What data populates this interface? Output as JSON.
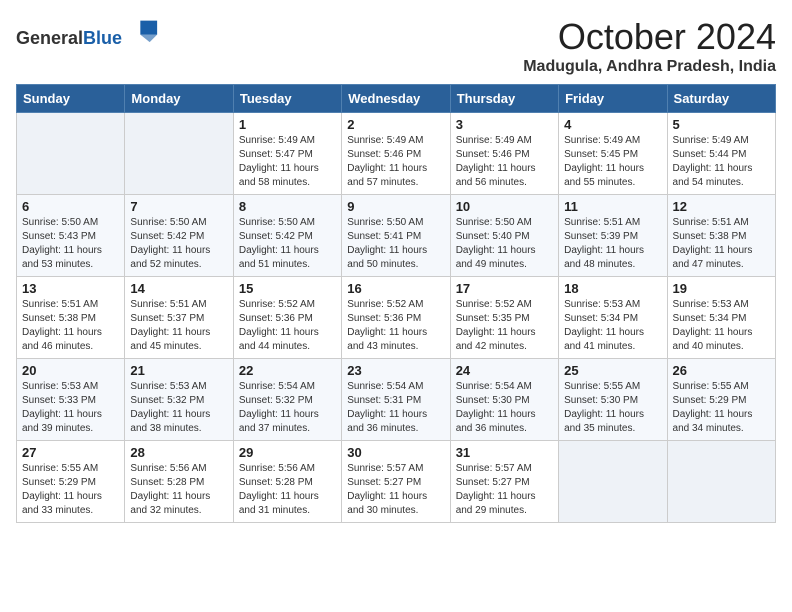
{
  "header": {
    "logo_general": "General",
    "logo_blue": "Blue",
    "month_title": "October 2024",
    "location": "Madugula, Andhra Pradesh, India"
  },
  "weekdays": [
    "Sunday",
    "Monday",
    "Tuesday",
    "Wednesday",
    "Thursday",
    "Friday",
    "Saturday"
  ],
  "weeks": [
    [
      {
        "day": "",
        "sunrise": "",
        "sunset": "",
        "daylight": ""
      },
      {
        "day": "",
        "sunrise": "",
        "sunset": "",
        "daylight": ""
      },
      {
        "day": "1",
        "sunrise": "Sunrise: 5:49 AM",
        "sunset": "Sunset: 5:47 PM",
        "daylight": "Daylight: 11 hours and 58 minutes."
      },
      {
        "day": "2",
        "sunrise": "Sunrise: 5:49 AM",
        "sunset": "Sunset: 5:46 PM",
        "daylight": "Daylight: 11 hours and 57 minutes."
      },
      {
        "day": "3",
        "sunrise": "Sunrise: 5:49 AM",
        "sunset": "Sunset: 5:46 PM",
        "daylight": "Daylight: 11 hours and 56 minutes."
      },
      {
        "day": "4",
        "sunrise": "Sunrise: 5:49 AM",
        "sunset": "Sunset: 5:45 PM",
        "daylight": "Daylight: 11 hours and 55 minutes."
      },
      {
        "day": "5",
        "sunrise": "Sunrise: 5:49 AM",
        "sunset": "Sunset: 5:44 PM",
        "daylight": "Daylight: 11 hours and 54 minutes."
      }
    ],
    [
      {
        "day": "6",
        "sunrise": "Sunrise: 5:50 AM",
        "sunset": "Sunset: 5:43 PM",
        "daylight": "Daylight: 11 hours and 53 minutes."
      },
      {
        "day": "7",
        "sunrise": "Sunrise: 5:50 AM",
        "sunset": "Sunset: 5:42 PM",
        "daylight": "Daylight: 11 hours and 52 minutes."
      },
      {
        "day": "8",
        "sunrise": "Sunrise: 5:50 AM",
        "sunset": "Sunset: 5:42 PM",
        "daylight": "Daylight: 11 hours and 51 minutes."
      },
      {
        "day": "9",
        "sunrise": "Sunrise: 5:50 AM",
        "sunset": "Sunset: 5:41 PM",
        "daylight": "Daylight: 11 hours and 50 minutes."
      },
      {
        "day": "10",
        "sunrise": "Sunrise: 5:50 AM",
        "sunset": "Sunset: 5:40 PM",
        "daylight": "Daylight: 11 hours and 49 minutes."
      },
      {
        "day": "11",
        "sunrise": "Sunrise: 5:51 AM",
        "sunset": "Sunset: 5:39 PM",
        "daylight": "Daylight: 11 hours and 48 minutes."
      },
      {
        "day": "12",
        "sunrise": "Sunrise: 5:51 AM",
        "sunset": "Sunset: 5:38 PM",
        "daylight": "Daylight: 11 hours and 47 minutes."
      }
    ],
    [
      {
        "day": "13",
        "sunrise": "Sunrise: 5:51 AM",
        "sunset": "Sunset: 5:38 PM",
        "daylight": "Daylight: 11 hours and 46 minutes."
      },
      {
        "day": "14",
        "sunrise": "Sunrise: 5:51 AM",
        "sunset": "Sunset: 5:37 PM",
        "daylight": "Daylight: 11 hours and 45 minutes."
      },
      {
        "day": "15",
        "sunrise": "Sunrise: 5:52 AM",
        "sunset": "Sunset: 5:36 PM",
        "daylight": "Daylight: 11 hours and 44 minutes."
      },
      {
        "day": "16",
        "sunrise": "Sunrise: 5:52 AM",
        "sunset": "Sunset: 5:36 PM",
        "daylight": "Daylight: 11 hours and 43 minutes."
      },
      {
        "day": "17",
        "sunrise": "Sunrise: 5:52 AM",
        "sunset": "Sunset: 5:35 PM",
        "daylight": "Daylight: 11 hours and 42 minutes."
      },
      {
        "day": "18",
        "sunrise": "Sunrise: 5:53 AM",
        "sunset": "Sunset: 5:34 PM",
        "daylight": "Daylight: 11 hours and 41 minutes."
      },
      {
        "day": "19",
        "sunrise": "Sunrise: 5:53 AM",
        "sunset": "Sunset: 5:34 PM",
        "daylight": "Daylight: 11 hours and 40 minutes."
      }
    ],
    [
      {
        "day": "20",
        "sunrise": "Sunrise: 5:53 AM",
        "sunset": "Sunset: 5:33 PM",
        "daylight": "Daylight: 11 hours and 39 minutes."
      },
      {
        "day": "21",
        "sunrise": "Sunrise: 5:53 AM",
        "sunset": "Sunset: 5:32 PM",
        "daylight": "Daylight: 11 hours and 38 minutes."
      },
      {
        "day": "22",
        "sunrise": "Sunrise: 5:54 AM",
        "sunset": "Sunset: 5:32 PM",
        "daylight": "Daylight: 11 hours and 37 minutes."
      },
      {
        "day": "23",
        "sunrise": "Sunrise: 5:54 AM",
        "sunset": "Sunset: 5:31 PM",
        "daylight": "Daylight: 11 hours and 36 minutes."
      },
      {
        "day": "24",
        "sunrise": "Sunrise: 5:54 AM",
        "sunset": "Sunset: 5:30 PM",
        "daylight": "Daylight: 11 hours and 36 minutes."
      },
      {
        "day": "25",
        "sunrise": "Sunrise: 5:55 AM",
        "sunset": "Sunset: 5:30 PM",
        "daylight": "Daylight: 11 hours and 35 minutes."
      },
      {
        "day": "26",
        "sunrise": "Sunrise: 5:55 AM",
        "sunset": "Sunset: 5:29 PM",
        "daylight": "Daylight: 11 hours and 34 minutes."
      }
    ],
    [
      {
        "day": "27",
        "sunrise": "Sunrise: 5:55 AM",
        "sunset": "Sunset: 5:29 PM",
        "daylight": "Daylight: 11 hours and 33 minutes."
      },
      {
        "day": "28",
        "sunrise": "Sunrise: 5:56 AM",
        "sunset": "Sunset: 5:28 PM",
        "daylight": "Daylight: 11 hours and 32 minutes."
      },
      {
        "day": "29",
        "sunrise": "Sunrise: 5:56 AM",
        "sunset": "Sunset: 5:28 PM",
        "daylight": "Daylight: 11 hours and 31 minutes."
      },
      {
        "day": "30",
        "sunrise": "Sunrise: 5:57 AM",
        "sunset": "Sunset: 5:27 PM",
        "daylight": "Daylight: 11 hours and 30 minutes."
      },
      {
        "day": "31",
        "sunrise": "Sunrise: 5:57 AM",
        "sunset": "Sunset: 5:27 PM",
        "daylight": "Daylight: 11 hours and 29 minutes."
      },
      {
        "day": "",
        "sunrise": "",
        "sunset": "",
        "daylight": ""
      },
      {
        "day": "",
        "sunrise": "",
        "sunset": "",
        "daylight": ""
      }
    ]
  ]
}
